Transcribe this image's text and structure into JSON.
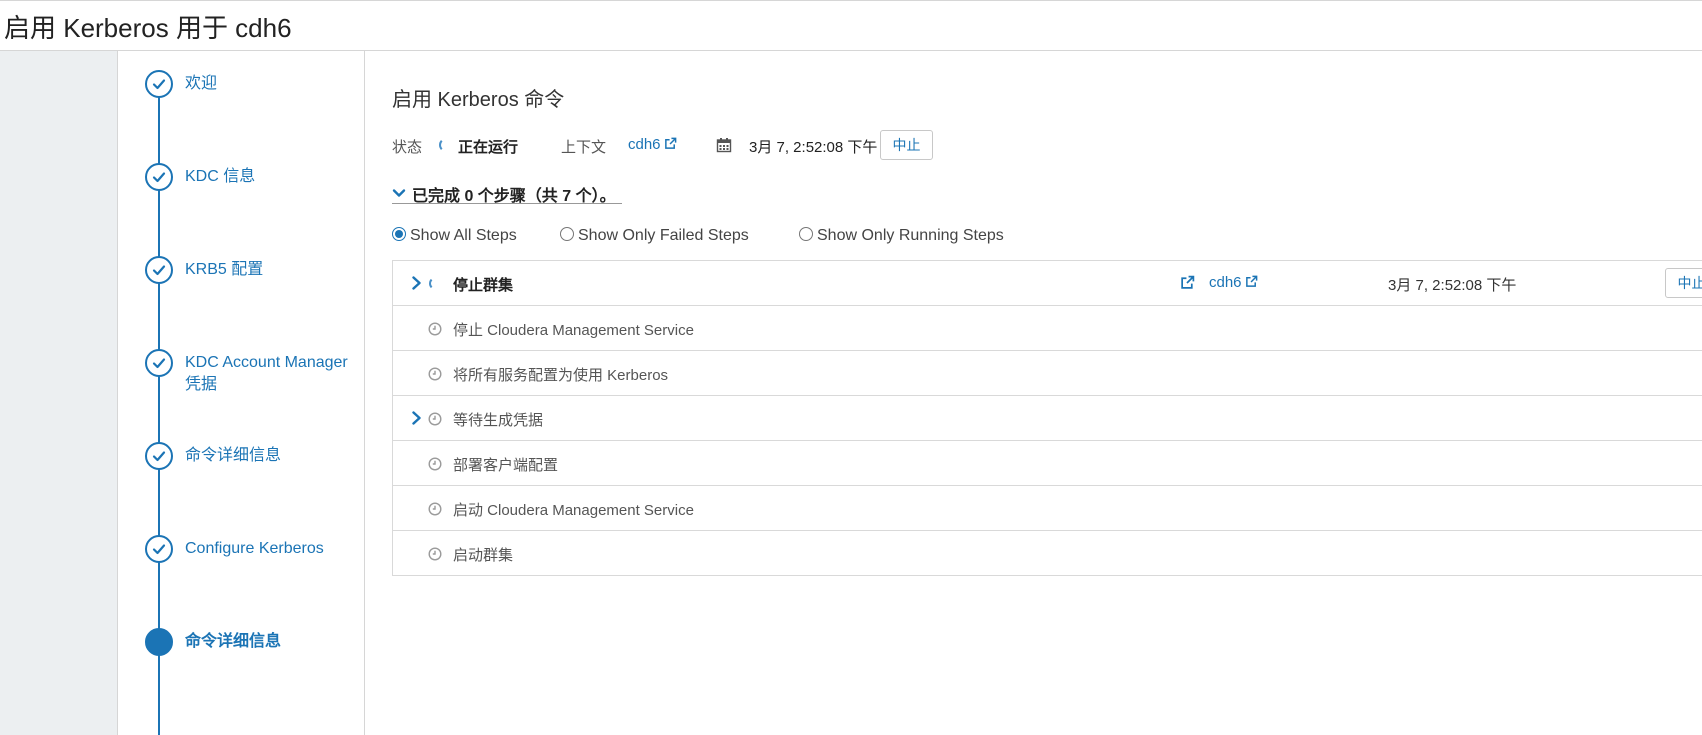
{
  "page": {
    "title": "启用 Kerberos 用于 cdh6"
  },
  "wizard": {
    "steps": [
      {
        "label": "欢迎",
        "state": "completed"
      },
      {
        "label": "KDC 信息",
        "state": "completed"
      },
      {
        "label": "KRB5 配置",
        "state": "completed"
      },
      {
        "label": "KDC Account Manager 凭据",
        "state": "completed"
      },
      {
        "label": "命令详细信息",
        "state": "completed"
      },
      {
        "label": "Configure Kerberos",
        "state": "completed"
      },
      {
        "label": "命令详细信息",
        "state": "current"
      }
    ]
  },
  "command": {
    "title": "启用 Kerberos 命令",
    "status_label": "状态",
    "status_value": "正在运行",
    "context_label": "上下文",
    "context_value": "cdh6",
    "date": "3月 7, 2:52:08 下午",
    "abort_label": "中止",
    "summary": "已完成 0 个步骤（共 7 个）。"
  },
  "filters": [
    {
      "label": "Show All Steps",
      "checked": true
    },
    {
      "label": "Show Only Failed Steps",
      "checked": false
    },
    {
      "label": "Show Only Running Steps",
      "checked": false
    }
  ],
  "steps": [
    {
      "name": "停止群集",
      "state": "running",
      "expandable": true,
      "context": "cdh6",
      "time": "3月 7, 2:52:08 下午",
      "abort_label": "中止"
    },
    {
      "name": "停止 Cloudera Management Service",
      "state": "pending",
      "expandable": false
    },
    {
      "name": "将所有服务配置为使用 Kerberos",
      "state": "pending",
      "expandable": false
    },
    {
      "name": "等待生成凭据",
      "state": "pending",
      "expandable": true
    },
    {
      "name": "部署客户端配置",
      "state": "pending",
      "expandable": false
    },
    {
      "name": "启动 Cloudera Management Service",
      "state": "pending",
      "expandable": false
    },
    {
      "name": "启动群集",
      "state": "pending",
      "expandable": false
    }
  ],
  "colors": {
    "accent": "#1b74b5",
    "border": "#d9d9d9",
    "gutter": "#eceff1"
  }
}
